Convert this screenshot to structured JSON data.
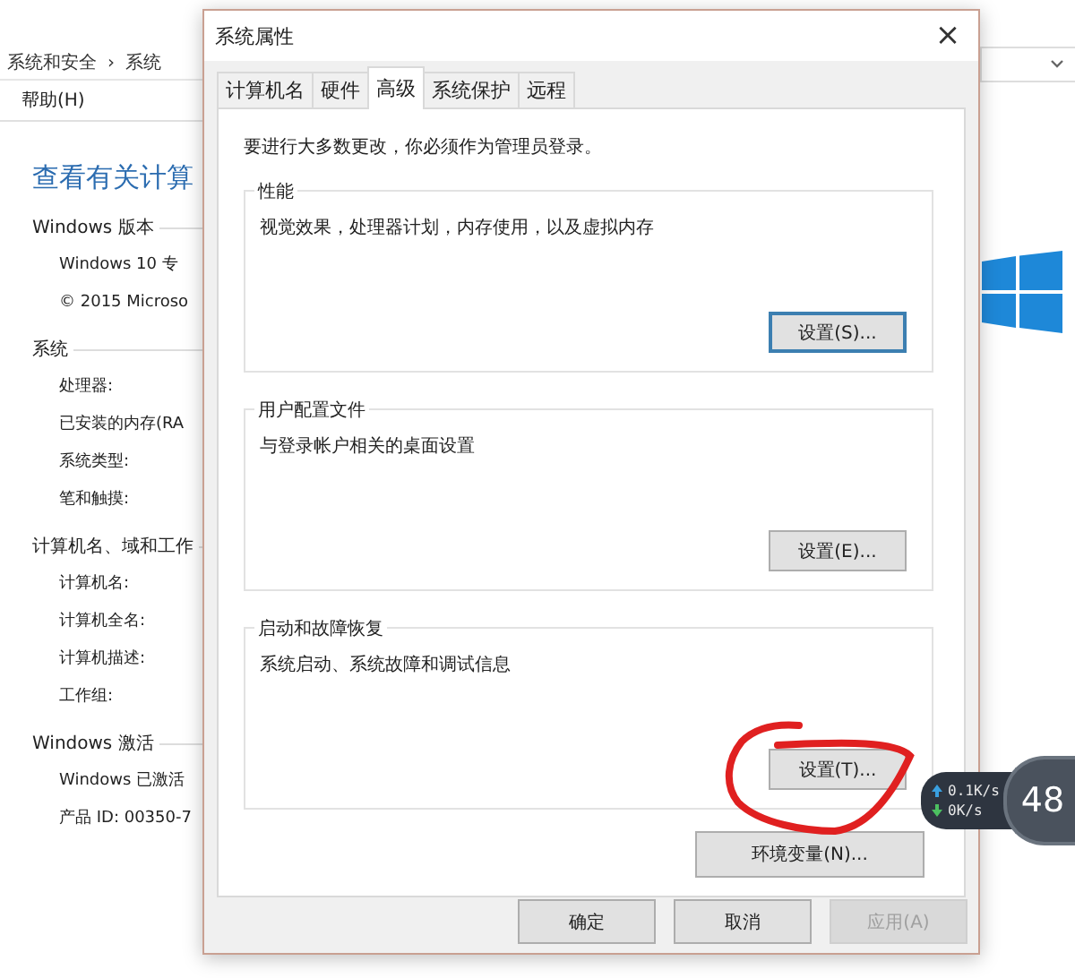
{
  "background_window": {
    "breadcrumb": [
      "系统和安全",
      "›",
      "系统"
    ],
    "menu": [
      "帮助(H)"
    ],
    "heading": "查看有关计算",
    "sections": [
      {
        "title": "Windows 版本",
        "rows": [
          "Windows 10 专",
          "© 2015 Microso"
        ]
      },
      {
        "title": "系统",
        "rows": [
          "处理器:",
          "已安装的内存(RA",
          "系统类型:",
          "笔和触摸:"
        ]
      },
      {
        "title": "计算机名、域和工作",
        "rows": [
          "计算机名:",
          "计算机全名:",
          "计算机描述:",
          "工作组:"
        ]
      },
      {
        "title": "Windows 激活",
        "rows": [
          "Windows 已激活",
          "产品 ID: 00350-7"
        ]
      }
    ]
  },
  "dialog": {
    "title": "系统属性",
    "close": "×",
    "tabs": [
      {
        "label": "计算机名",
        "selected": false
      },
      {
        "label": "硬件",
        "selected": false
      },
      {
        "label": "高级",
        "selected": true
      },
      {
        "label": "系统保护",
        "selected": false
      },
      {
        "label": "远程",
        "selected": false
      }
    ],
    "notice": "要进行大多数更改，你必须作为管理员登录。",
    "groups": [
      {
        "title": "性能",
        "description": "视觉效果，处理器计划，内存使用，以及虚拟内存",
        "button": "设置(S)...",
        "focused": true,
        "circled": false
      },
      {
        "title": "用户配置文件",
        "description": "与登录帐户相关的桌面设置",
        "button": "设置(E)...",
        "focused": false,
        "circled": false
      },
      {
        "title": "启动和故障恢复",
        "description": "系统启动、系统故障和调试信息",
        "button": "设置(T)...",
        "focused": false,
        "circled": true
      }
    ],
    "env_button": "环境变量(N)...",
    "footer_buttons": [
      {
        "label": "确定",
        "disabled": false
      },
      {
        "label": "取消",
        "disabled": false
      },
      {
        "label": "应用(A)",
        "disabled": true
      }
    ]
  },
  "network_widget": {
    "upload": "0.1K/s",
    "download": "0K/s",
    "percent": "48"
  }
}
